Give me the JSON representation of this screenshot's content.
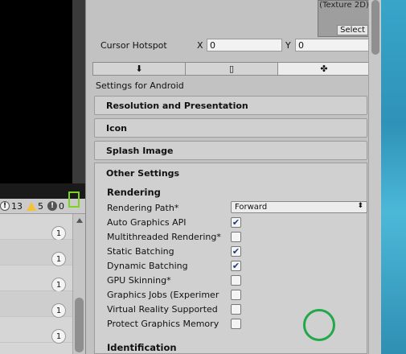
{
  "texture_preview": {
    "name": "(Texture 2D)",
    "select_label": "Select"
  },
  "cursor_hotspot": {
    "label": "Cursor Hotspot",
    "x_label": "X",
    "x_value": "0",
    "y_label": "Y",
    "y_value": "0"
  },
  "platform_tabs": [
    {
      "icon": "download-icon",
      "glyph": "⬇"
    },
    {
      "icon": "mobile-icon",
      "glyph": "▯"
    },
    {
      "icon": "android-icon",
      "glyph": "✤"
    }
  ],
  "settings_title": "Settings for Android",
  "sections": {
    "resolution": "Resolution and Presentation",
    "icon": "Icon",
    "splash": "Splash Image",
    "other": "Other Settings"
  },
  "rendering": {
    "title": "Rendering",
    "path_label": "Rendering Path*",
    "path_value": "Forward",
    "options": [
      {
        "label": "Auto Graphics API",
        "checked": true
      },
      {
        "label": "Multithreaded Rendering*",
        "checked": false
      },
      {
        "label": "Static Batching",
        "checked": true
      },
      {
        "label": "Dynamic Batching",
        "checked": true
      },
      {
        "label": "GPU Skinning*",
        "checked": false
      },
      {
        "label": "Graphics Jobs (Experimer",
        "checked": false
      },
      {
        "label": "Virtual Reality Supported",
        "checked": false
      },
      {
        "label": "Protect Graphics Memory",
        "checked": false
      }
    ]
  },
  "identification_title": "Identification",
  "console": {
    "info_count": "13",
    "warn_count": "5",
    "error_count": "0",
    "rows": [
      "1",
      "1",
      "1",
      "1",
      "1"
    ]
  },
  "colors": {
    "highlight": "#22a84a",
    "console_menu_outline": "#7ed320"
  }
}
